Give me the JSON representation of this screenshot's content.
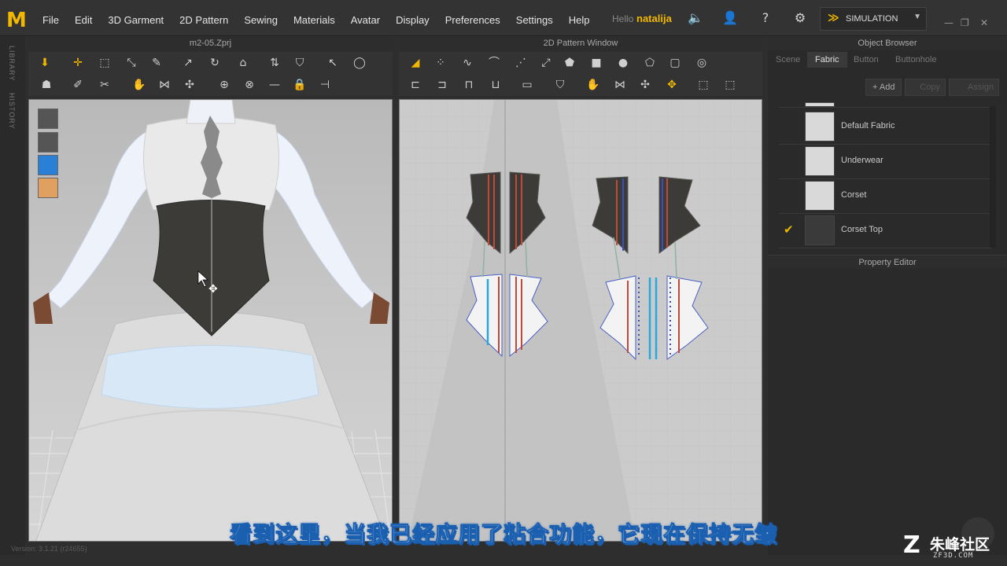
{
  "app": {
    "logo": "M"
  },
  "menu": [
    "File",
    "Edit",
    "3D Garment",
    "2D Pattern",
    "Sewing",
    "Materials",
    "Avatar",
    "Display",
    "Preferences",
    "Settings",
    "Help"
  ],
  "user": {
    "hello": "Hello",
    "name": "natalija"
  },
  "simulation": {
    "label": "SIMULATION"
  },
  "left_strip": {
    "library": "LIBRARY",
    "history": "HISTORY"
  },
  "panels": {
    "view3d_title": "m2-05.Zprj",
    "view2d_title": "2D Pattern Window",
    "object_browser_title": "Object Browser",
    "property_editor_title": "Property Editor"
  },
  "object_browser": {
    "tabs": [
      "Scene",
      "Fabric",
      "Button",
      "Buttonhole"
    ],
    "active_tab": "Fabric",
    "buttons": {
      "add": "Add",
      "copy": "Copy",
      "assign": "Assign"
    },
    "fabrics": [
      {
        "name": "Default Fabric",
        "color": "#d9d9d9",
        "checked": false
      },
      {
        "name": "Underwear",
        "color": "#d9d9d9",
        "checked": false
      },
      {
        "name": "Corset",
        "color": "#d9d9d9",
        "checked": false
      },
      {
        "name": "Corset Top",
        "color": "#3a3a3a",
        "checked": true
      }
    ]
  },
  "status": {
    "version": "Version: 3.1.21",
    "build": "(r24655)"
  },
  "subtitle": "看到这里，当我已经应用了粘合功能，它现在保持无皱",
  "watermark": {
    "name": "朱峰社区",
    "url": "ZF3D.COM"
  },
  "colors": {
    "accent": "#f2b800",
    "panel_bg": "#2a2a2a",
    "viewport_bg": "#c4c4c4"
  }
}
